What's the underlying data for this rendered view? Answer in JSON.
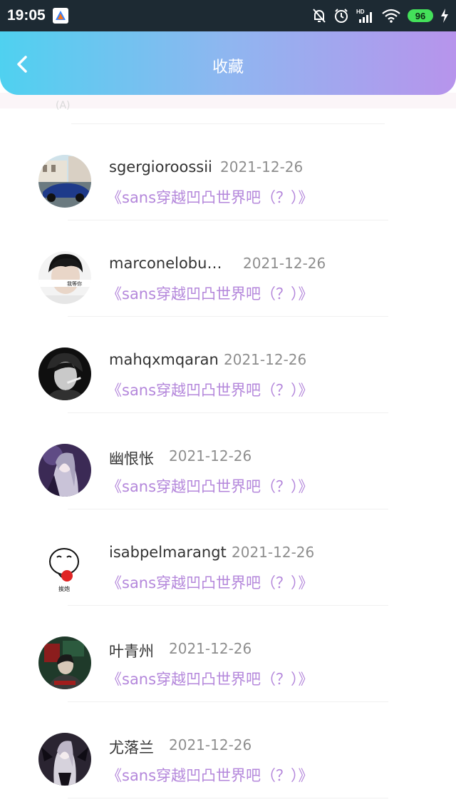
{
  "status_bar": {
    "time": "19:05",
    "network_label": "HD",
    "battery": "96"
  },
  "header": {
    "title": "收藏"
  },
  "prev_fragment": "(A)",
  "items": [
    {
      "name": "sgergioroossii",
      "date": "2021-12-26",
      "work": "《sans穿越凹凸世界吧（？）》"
    },
    {
      "name": "marconeloburl...",
      "date": "2021-12-26",
      "work": "《sans穿越凹凸世界吧（？）》"
    },
    {
      "name": "mahqxmqaran",
      "date": "2021-12-26",
      "work": "《sans穿越凹凸世界吧（？）》"
    },
    {
      "name": "幽恨怅",
      "date": "2021-12-26",
      "work": "《sans穿越凹凸世界吧（？）》"
    },
    {
      "name": "isabpelmarangt",
      "date": "2021-12-26",
      "work": "《sans穿越凹凸世界吧（？）》"
    },
    {
      "name": "叶青州",
      "date": "2021-12-26",
      "work": "《sans穿越凹凸世界吧（？）》"
    },
    {
      "name": "尤落兰",
      "date": "2021-12-26",
      "work": "《sans穿越凹凸世界吧（？）》"
    }
  ],
  "avatar_overlays": {
    "item_1": "我等你",
    "item_4": "挨炮"
  },
  "colors": {
    "header_gradient_start": "#4fd1f0",
    "header_gradient_end": "#b794ec",
    "work_link": "#b487db",
    "date": "#8e8e8e"
  },
  "icons": {
    "back": "chevron-left-icon",
    "mute": "bell-off-icon",
    "alarm": "alarm-icon",
    "signal": "signal-icon",
    "wifi": "wifi-icon",
    "charging": "bolt-icon"
  }
}
